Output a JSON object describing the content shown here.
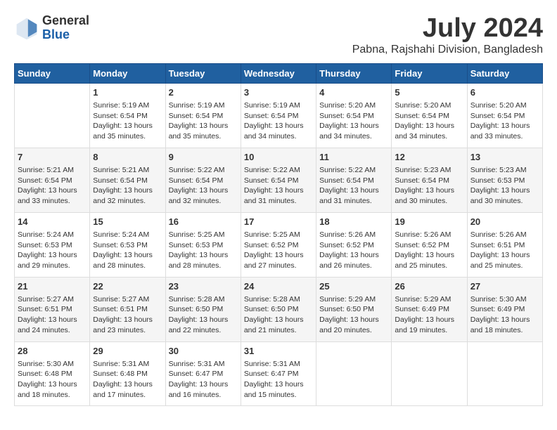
{
  "header": {
    "logo_general": "General",
    "logo_blue": "Blue",
    "month_year": "July 2024",
    "location": "Pabna, Rajshahi Division, Bangladesh"
  },
  "days_of_week": [
    "Sunday",
    "Monday",
    "Tuesday",
    "Wednesday",
    "Thursday",
    "Friday",
    "Saturday"
  ],
  "weeks": [
    [
      {
        "day": "",
        "info": ""
      },
      {
        "day": "1",
        "info": "Sunrise: 5:19 AM\nSunset: 6:54 PM\nDaylight: 13 hours\nand 35 minutes."
      },
      {
        "day": "2",
        "info": "Sunrise: 5:19 AM\nSunset: 6:54 PM\nDaylight: 13 hours\nand 35 minutes."
      },
      {
        "day": "3",
        "info": "Sunrise: 5:19 AM\nSunset: 6:54 PM\nDaylight: 13 hours\nand 34 minutes."
      },
      {
        "day": "4",
        "info": "Sunrise: 5:20 AM\nSunset: 6:54 PM\nDaylight: 13 hours\nand 34 minutes."
      },
      {
        "day": "5",
        "info": "Sunrise: 5:20 AM\nSunset: 6:54 PM\nDaylight: 13 hours\nand 34 minutes."
      },
      {
        "day": "6",
        "info": "Sunrise: 5:20 AM\nSunset: 6:54 PM\nDaylight: 13 hours\nand 33 minutes."
      }
    ],
    [
      {
        "day": "7",
        "info": "Sunrise: 5:21 AM\nSunset: 6:54 PM\nDaylight: 13 hours\nand 33 minutes."
      },
      {
        "day": "8",
        "info": "Sunrise: 5:21 AM\nSunset: 6:54 PM\nDaylight: 13 hours\nand 32 minutes."
      },
      {
        "day": "9",
        "info": "Sunrise: 5:22 AM\nSunset: 6:54 PM\nDaylight: 13 hours\nand 32 minutes."
      },
      {
        "day": "10",
        "info": "Sunrise: 5:22 AM\nSunset: 6:54 PM\nDaylight: 13 hours\nand 31 minutes."
      },
      {
        "day": "11",
        "info": "Sunrise: 5:22 AM\nSunset: 6:54 PM\nDaylight: 13 hours\nand 31 minutes."
      },
      {
        "day": "12",
        "info": "Sunrise: 5:23 AM\nSunset: 6:54 PM\nDaylight: 13 hours\nand 30 minutes."
      },
      {
        "day": "13",
        "info": "Sunrise: 5:23 AM\nSunset: 6:53 PM\nDaylight: 13 hours\nand 30 minutes."
      }
    ],
    [
      {
        "day": "14",
        "info": "Sunrise: 5:24 AM\nSunset: 6:53 PM\nDaylight: 13 hours\nand 29 minutes."
      },
      {
        "day": "15",
        "info": "Sunrise: 5:24 AM\nSunset: 6:53 PM\nDaylight: 13 hours\nand 28 minutes."
      },
      {
        "day": "16",
        "info": "Sunrise: 5:25 AM\nSunset: 6:53 PM\nDaylight: 13 hours\nand 28 minutes."
      },
      {
        "day": "17",
        "info": "Sunrise: 5:25 AM\nSunset: 6:52 PM\nDaylight: 13 hours\nand 27 minutes."
      },
      {
        "day": "18",
        "info": "Sunrise: 5:26 AM\nSunset: 6:52 PM\nDaylight: 13 hours\nand 26 minutes."
      },
      {
        "day": "19",
        "info": "Sunrise: 5:26 AM\nSunset: 6:52 PM\nDaylight: 13 hours\nand 25 minutes."
      },
      {
        "day": "20",
        "info": "Sunrise: 5:26 AM\nSunset: 6:51 PM\nDaylight: 13 hours\nand 25 minutes."
      }
    ],
    [
      {
        "day": "21",
        "info": "Sunrise: 5:27 AM\nSunset: 6:51 PM\nDaylight: 13 hours\nand 24 minutes."
      },
      {
        "day": "22",
        "info": "Sunrise: 5:27 AM\nSunset: 6:51 PM\nDaylight: 13 hours\nand 23 minutes."
      },
      {
        "day": "23",
        "info": "Sunrise: 5:28 AM\nSunset: 6:50 PM\nDaylight: 13 hours\nand 22 minutes."
      },
      {
        "day": "24",
        "info": "Sunrise: 5:28 AM\nSunset: 6:50 PM\nDaylight: 13 hours\nand 21 minutes."
      },
      {
        "day": "25",
        "info": "Sunrise: 5:29 AM\nSunset: 6:50 PM\nDaylight: 13 hours\nand 20 minutes."
      },
      {
        "day": "26",
        "info": "Sunrise: 5:29 AM\nSunset: 6:49 PM\nDaylight: 13 hours\nand 19 minutes."
      },
      {
        "day": "27",
        "info": "Sunrise: 5:30 AM\nSunset: 6:49 PM\nDaylight: 13 hours\nand 18 minutes."
      }
    ],
    [
      {
        "day": "28",
        "info": "Sunrise: 5:30 AM\nSunset: 6:48 PM\nDaylight: 13 hours\nand 18 minutes."
      },
      {
        "day": "29",
        "info": "Sunrise: 5:31 AM\nSunset: 6:48 PM\nDaylight: 13 hours\nand 17 minutes."
      },
      {
        "day": "30",
        "info": "Sunrise: 5:31 AM\nSunset: 6:47 PM\nDaylight: 13 hours\nand 16 minutes."
      },
      {
        "day": "31",
        "info": "Sunrise: 5:31 AM\nSunset: 6:47 PM\nDaylight: 13 hours\nand 15 minutes."
      },
      {
        "day": "",
        "info": ""
      },
      {
        "day": "",
        "info": ""
      },
      {
        "day": "",
        "info": ""
      }
    ]
  ]
}
